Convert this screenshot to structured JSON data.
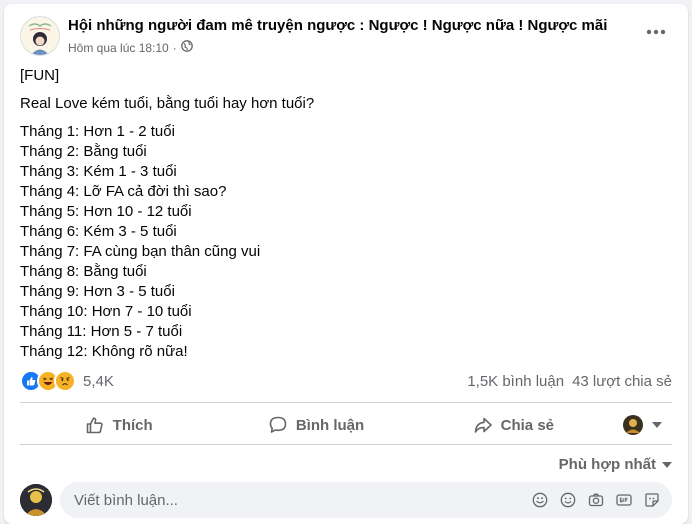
{
  "post": {
    "group_name": "Hội những người đam mê truyện ngược : Ngược ! Ngược nữa ! Ngược mãi",
    "timestamp": "Hôm qua lúc 18:10",
    "separator": "·",
    "privacy_icon": "globe-icon",
    "more_icon": "more-horizontal-icon",
    "tag": "[FUN]",
    "question": "Real Love kém tuổi, bằng tuổi hay hơn tuổi?",
    "months": [
      "Tháng 1: Hơn 1 - 2 tuổi",
      "Tháng 2: Bằng tuổi",
      "Tháng 3: Kém 1 - 3 tuổi",
      "Tháng 4: Lỡ FA cả đời thì sao?",
      "Tháng 5: Hơn 10 - 12 tuổi",
      "Tháng 6: Kém 3 - 5 tuổi",
      "Tháng 7: FA cùng bạn thân cũng vui",
      "Tháng 8: Bằng tuổi",
      "Tháng 9: Hơn 3 - 5 tuổi",
      "Tháng 10: Hơn 7 - 10 tuổi",
      "Tháng 11: Hơn 5 - 7 tuổi",
      "Tháng 12: Không rõ nữa!"
    ]
  },
  "stats": {
    "reaction_icons": [
      "like-reaction-icon",
      "haha-reaction-icon",
      "care-reaction-icon"
    ],
    "reaction_count": "5,4K",
    "comments": "1,5K bình luận",
    "shares": "43 lượt chia sẻ"
  },
  "actions": {
    "like": "Thích",
    "comment": "Bình luận",
    "share": "Chia sẻ"
  },
  "sort": {
    "label": "Phù hợp nhất"
  },
  "comment_box": {
    "placeholder": "Viết bình luận...",
    "icons": [
      "sticker-icon",
      "emoji-icon",
      "camera-icon",
      "gif-icon",
      "avatar-sticker-icon"
    ]
  },
  "colors": {
    "text_primary": "#050505",
    "text_secondary": "#65676b",
    "like_blue": "#1877f2",
    "haha_yellow": "#f7b125",
    "background": "#f0f2f5"
  }
}
